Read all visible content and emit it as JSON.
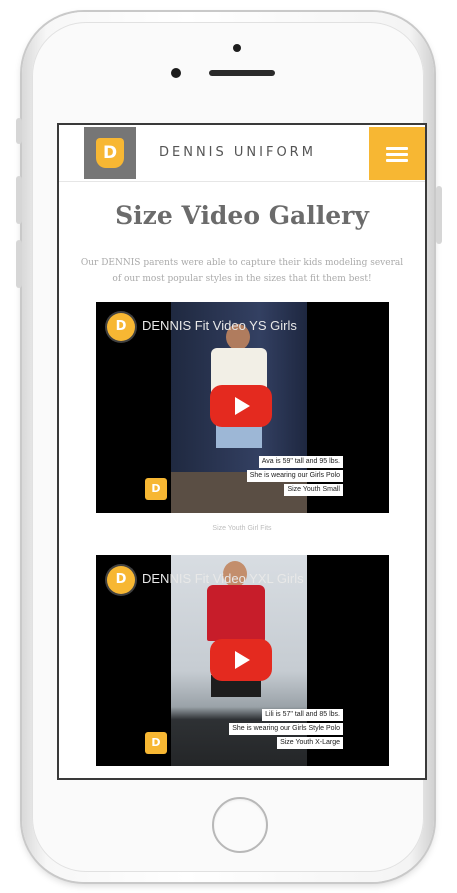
{
  "site": {
    "logo_letter": "D",
    "brand": "DENNIS UNIFORM",
    "title": "Size Video Gallery",
    "intro": "Our DENNIS parents were able to capture their kids modeling several of our most popular styles in the sizes that fit them best!"
  },
  "videos": [
    {
      "title": "DENNIS Fit Video YS Girls",
      "captions": [
        "Ava is 59\" tall and 95 lbs.",
        "She is wearing our Girls Polo",
        "Size Youth Small"
      ],
      "watermark": "D",
      "label": "Size Youth Girl Fits"
    },
    {
      "title": "DENNIS Fit Video YXL Girls",
      "captions": [
        "Lili is 57\" tall and 85 lbs.",
        "She is wearing our Girls Style Polo",
        "Size Youth X-Large"
      ],
      "watermark": "D"
    }
  ],
  "colors": {
    "accent": "#f7b733",
    "logo_bg": "#767676",
    "play": "#e42a1f"
  },
  "icons": {
    "menu": "hamburger-icon",
    "play": "play-icon",
    "channel": "channel-logo-icon"
  }
}
